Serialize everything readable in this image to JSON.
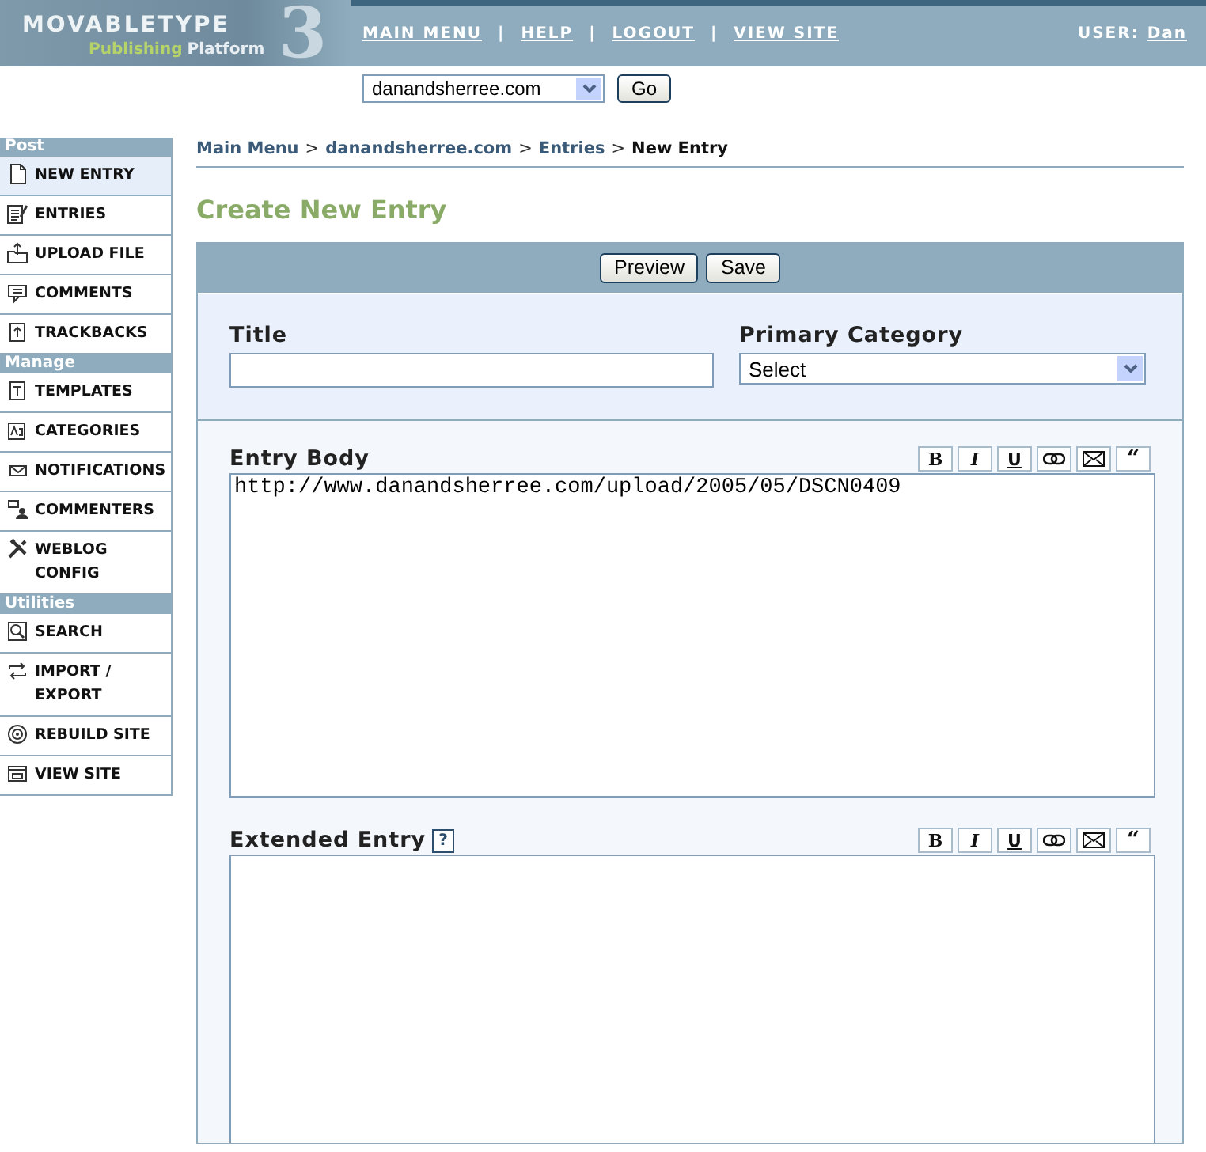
{
  "logo": {
    "wordmark": "MOVABLETYPE",
    "tagline_1": "Publishing",
    "tagline_2": "Platform",
    "version": "3"
  },
  "nav": {
    "links": [
      "MAIN MENU",
      "HELP",
      "LOGOUT",
      "VIEW SITE"
    ],
    "separator": "|",
    "user_label": "USER:",
    "user_name": "Dan"
  },
  "site_picker": {
    "value": "danandsherree.com",
    "button": "Go"
  },
  "sidebar": {
    "sections": [
      {
        "title": "Post",
        "items": [
          {
            "label": "NEW ENTRY",
            "selected": true
          },
          {
            "label": "ENTRIES",
            "selected": false
          },
          {
            "label": "UPLOAD FILE",
            "selected": false
          },
          {
            "label": "COMMENTS",
            "selected": false
          },
          {
            "label": "TRACKBACKS",
            "selected": false
          }
        ]
      },
      {
        "title": "Manage",
        "items": [
          {
            "label": "TEMPLATES",
            "selected": false
          },
          {
            "label": "CATEGORIES",
            "selected": false
          },
          {
            "label": "NOTIFICATIONS",
            "selected": false
          },
          {
            "label": "COMMENTERS",
            "selected": false
          },
          {
            "label": "WEBLOG\nCONFIG",
            "selected": false
          }
        ]
      },
      {
        "title": "Utilities",
        "items": [
          {
            "label": "SEARCH",
            "selected": false
          },
          {
            "label": "IMPORT /\nEXPORT",
            "selected": false
          },
          {
            "label": "REBUILD SITE",
            "selected": false
          },
          {
            "label": "VIEW SITE",
            "selected": false
          }
        ]
      }
    ]
  },
  "breadcrumb": {
    "links": [
      "Main Menu",
      "danandsherree.com",
      "Entries"
    ],
    "separator": ">",
    "current": "New Entry"
  },
  "page_title": "Create New Entry",
  "actions": [
    "Preview",
    "Save"
  ],
  "form": {
    "title_label": "Title",
    "category_label": "Primary Category",
    "category_value": "Select",
    "entry_body": {
      "label": "Entry Body",
      "value": "http://www.danandsherree.com/upload/2005/05/DSCN0409",
      "format_buttons": [
        {
          "kind": "bold",
          "label": "B"
        },
        {
          "kind": "italic",
          "label": "I"
        },
        {
          "kind": "underline",
          "label": "U"
        },
        {
          "kind": "link"
        },
        {
          "kind": "mail"
        },
        {
          "kind": "quote",
          "label": "“"
        }
      ]
    },
    "extended_entry": {
      "label": "Extended Entry",
      "help": "?",
      "format_buttons": [
        {
          "kind": "bold",
          "label": "B"
        },
        {
          "kind": "italic",
          "label": "I"
        },
        {
          "kind": "underline",
          "label": "U"
        },
        {
          "kind": "link"
        },
        {
          "kind": "mail"
        },
        {
          "kind": "quote",
          "label": "“"
        }
      ]
    }
  }
}
